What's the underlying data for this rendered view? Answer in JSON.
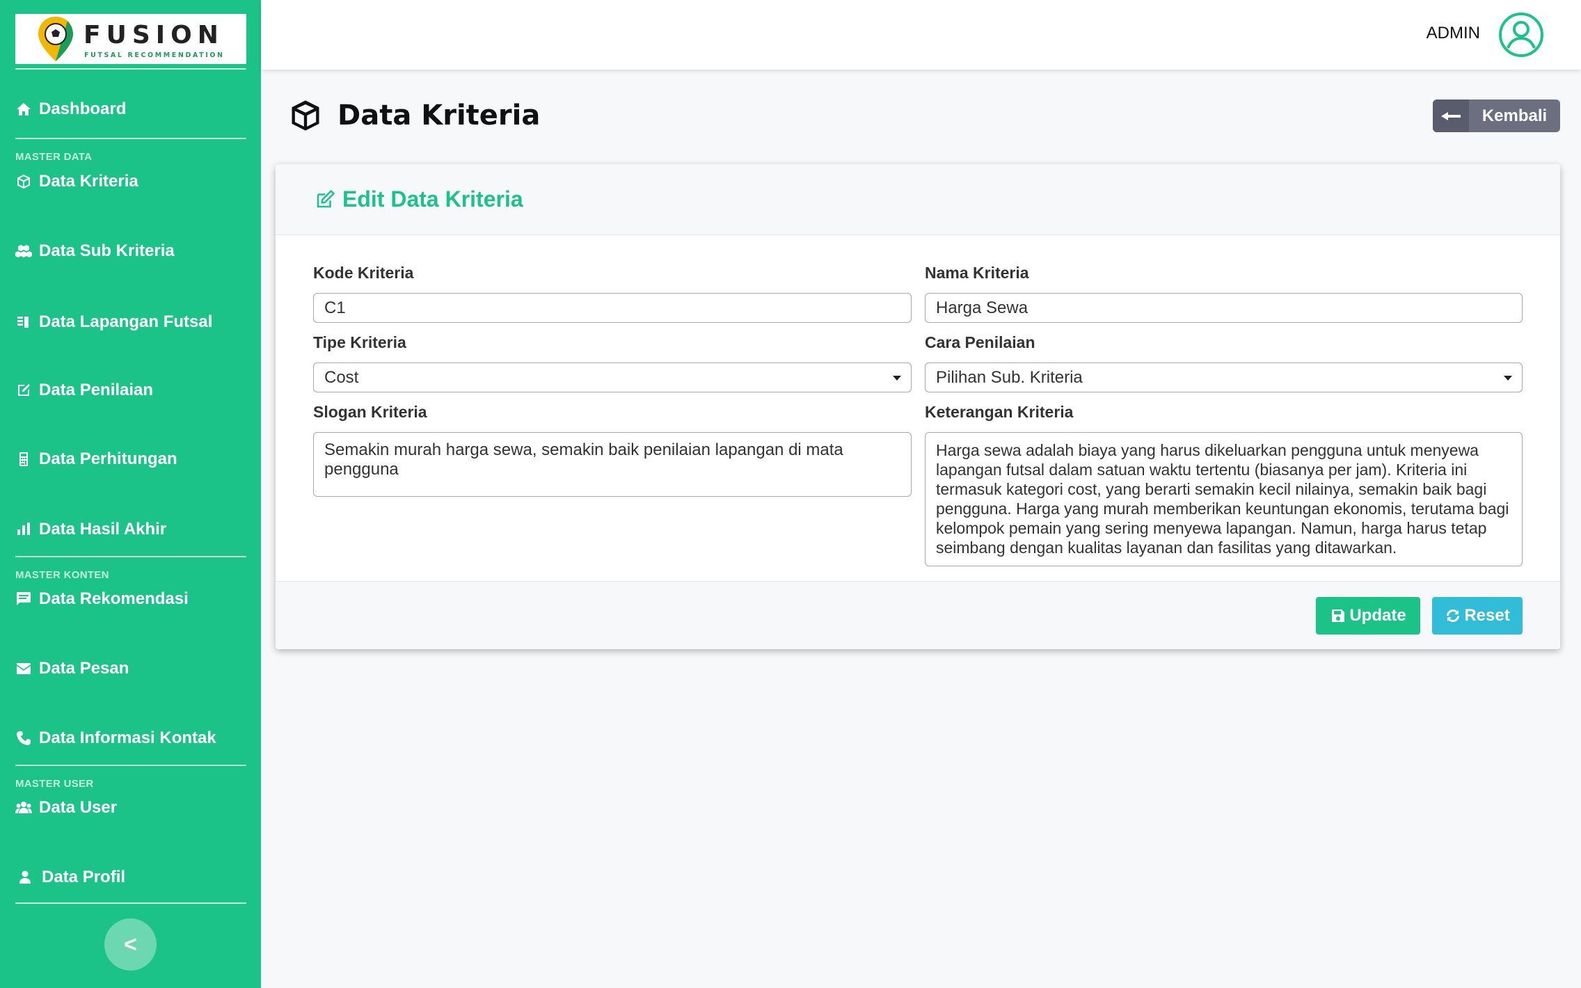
{
  "brand": {
    "title": "FUSION",
    "subtitle": "FUTSAL RECOMMENDATION"
  },
  "sidebar": {
    "items": [
      {
        "label": "Dashboard",
        "icon": "home-icon"
      },
      {
        "label": "Data Kriteria",
        "icon": "cube-icon"
      },
      {
        "label": "Data Sub Kriteria",
        "icon": "cubes-icon"
      },
      {
        "label": "Data Lapangan Futsal",
        "icon": "list-icon"
      },
      {
        "label": "Data Penilaian",
        "icon": "edit-square-icon"
      },
      {
        "label": "Data Perhitungan",
        "icon": "calculator-icon"
      },
      {
        "label": "Data Hasil Akhir",
        "icon": "bar-chart-icon"
      },
      {
        "label": "Data Rekomendasi",
        "icon": "message-icon"
      },
      {
        "label": "Data Pesan",
        "icon": "envelope-icon"
      },
      {
        "label": "Data Informasi Kontak",
        "icon": "phone-icon"
      },
      {
        "label": "Data User",
        "icon": "users-icon"
      },
      {
        "label": "Data Profil",
        "icon": "user-icon"
      }
    ],
    "sections": [
      "MASTER DATA",
      "MASTER KONTEN",
      "MASTER USER"
    ],
    "collapse_label": "<"
  },
  "topbar": {
    "user_label": "ADMIN"
  },
  "page": {
    "title": "Data Kriteria",
    "back_label": "Kembali"
  },
  "form": {
    "title": "Edit Data Kriteria",
    "kode": {
      "label": "Kode Kriteria",
      "value": "C1"
    },
    "nama": {
      "label": "Nama Kriteria",
      "value": "Harga Sewa"
    },
    "tipe": {
      "label": "Tipe Kriteria",
      "value": "Cost"
    },
    "cara": {
      "label": "Cara Penilaian",
      "value": "Pilihan Sub. Kriteria"
    },
    "slogan": {
      "label": "Slogan Kriteria",
      "value": "Semakin murah harga sewa, semakin baik penilaian lapangan di mata pengguna"
    },
    "keterangan": {
      "label": "Keterangan Kriteria",
      "value": "Harga sewa adalah biaya yang harus dikeluarkan pengguna untuk menyewa lapangan futsal dalam satuan waktu tertentu (biasanya per jam). Kriteria ini termasuk kategori cost, yang berarti semakin kecil nilainya, semakin baik bagi pengguna. Harga yang murah memberikan keuntungan ekonomis, terutama bagi kelompok pemain yang sering menyewa lapangan. Namun, harga harus tetap seimbang dengan kualitas layanan dan fasilitas yang ditawarkan."
    },
    "update_label": "Update",
    "reset_label": "Reset"
  },
  "colors": {
    "primary": "#1cc389",
    "info": "#31bcd8",
    "secondary": "#6b6f80"
  }
}
